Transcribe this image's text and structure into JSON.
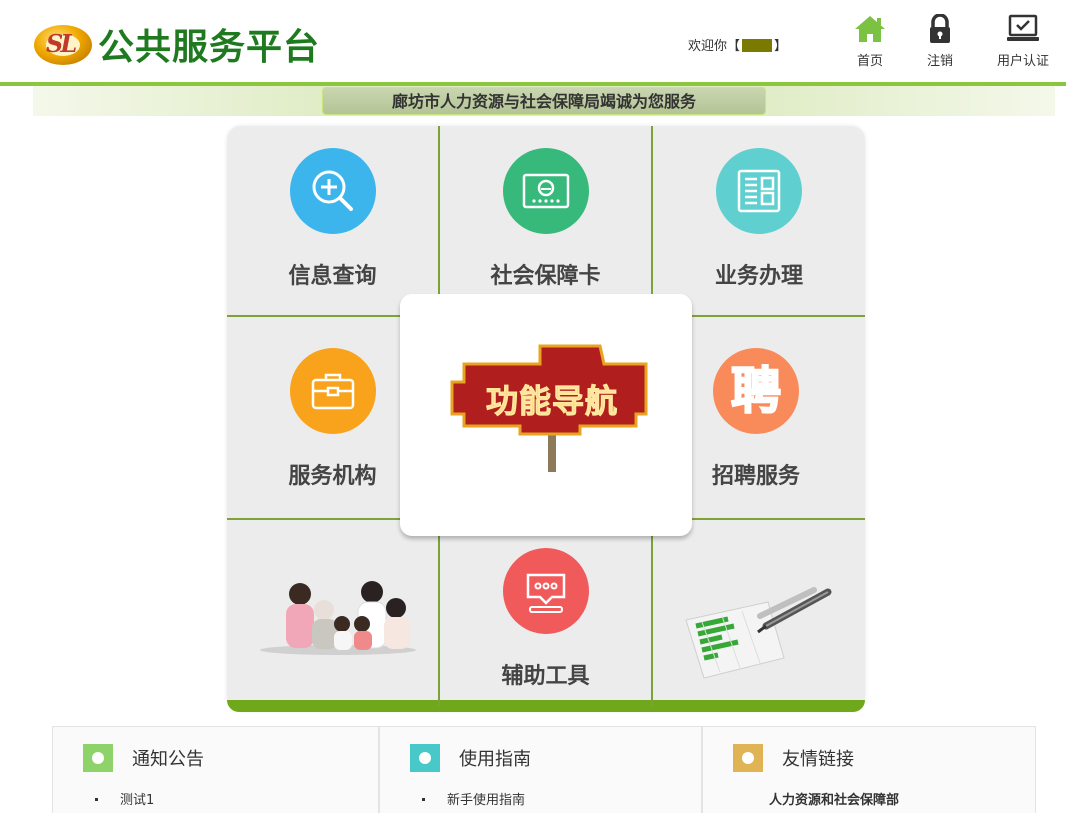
{
  "header": {
    "logo_text": "SL",
    "site_title": "公共服务平台",
    "welcome_prefix": "欢迎你【",
    "welcome_suffix": "】",
    "nav": {
      "home_label": "首页",
      "logout_label": "注销",
      "auth_label": "用户认证"
    }
  },
  "banner": {
    "slogan": "廊坊市人力资源与社会保障局竭诚为您服务"
  },
  "grid": {
    "info_query": {
      "label": "信息查询",
      "icon": "search-icon",
      "color": "#3cb4ec"
    },
    "ss_card": {
      "label": "社会保障卡",
      "icon": "card-icon",
      "color": "#36b97b"
    },
    "business": {
      "label": "业务办理",
      "icon": "document-icon",
      "color": "#5fcfcf"
    },
    "agencies": {
      "label": "服务机构",
      "icon": "briefcase-icon",
      "color": "#f9a21b"
    },
    "recruit": {
      "label": "招聘服务",
      "icon": "recruit-icon",
      "icon_text": "聘",
      "color": "#f98b5a"
    },
    "tools": {
      "label": "辅助工具",
      "icon": "chat-icon",
      "color": "#f05a5a"
    },
    "center": {
      "sign_text": "功能导航"
    }
  },
  "info_panels": {
    "notice": {
      "title": "通知公告",
      "items": [
        "测试1"
      ],
      "color": "#8ed36a"
    },
    "guide": {
      "title": "使用指南",
      "items": [
        "新手使用指南"
      ],
      "color": "#48c8c8"
    },
    "links": {
      "title": "友情链接",
      "items": [
        "人力资源和社会保障部"
      ],
      "color": "#e0b454"
    }
  },
  "colors": {
    "accent_green": "#8cc63f",
    "grid_line": "#7ea23a",
    "panel_bg": "#ececec"
  }
}
